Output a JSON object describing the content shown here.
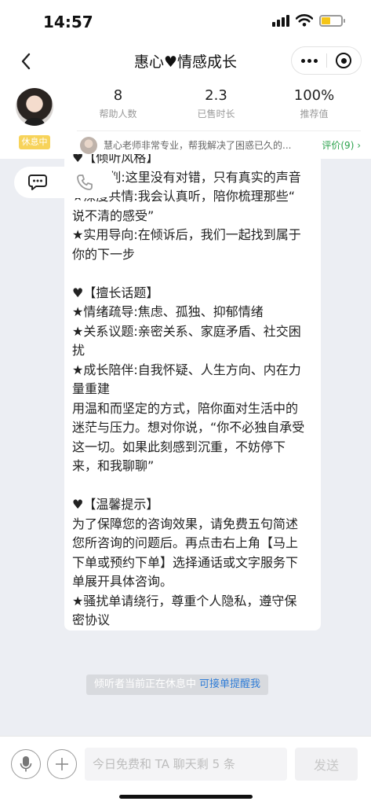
{
  "status_bar": {
    "time": "14:57"
  },
  "nav": {
    "title": "惠心♥情感成长"
  },
  "profile": {
    "status_badge": "休息中",
    "stats": [
      {
        "value": "8",
        "label": "帮助人数"
      },
      {
        "value": "2.3",
        "label": "已售时长"
      },
      {
        "value": "100%",
        "label": "推荐值"
      }
    ],
    "review_text": "慧心老师非常专业，帮我解决了困惑已久的...",
    "review_link": "评价(9) ›"
  },
  "message": {
    "lines": [
      "♥【倾听风格】",
      "★不评判:这里没有对错，只有真实的声音",
      "★深度共情:我会认真听，陪你梳理那些“",
      "说不清的感受”",
      "★实用导向:在倾诉后，我们一起找到属于",
      "你的下一步",
      "",
      "♥【擅长话题】",
      "★情绪疏导:焦虑、孤独、抑郁情绪",
      "★关系议题:亲密关系、家庭矛盾、社交困",
      "扰",
      "★成长陪伴:自我怀疑、人生方向、内在力",
      "量重建",
      "用温和而坚定的方式，陪你面对生活中的",
      "迷茫与压力。想对你说，“你不必独自承受",
      "这一切。如果此刻感到沉重，不妨停下",
      "来，和我聊聊”",
      "",
      "♥【温馨提示】",
      "为了保障您的咨询效果，请免费五句简述",
      "您所咨询的问题后。再点击右上角【马上",
      "下单或预约下单】选择通话或文字服务下",
      "单展开具体咨询。",
      "★骚扰单请绕行，尊重个人隐私，遵守保",
      "密协议"
    ]
  },
  "notice": {
    "text": "倾听者当前正在休息中",
    "link": "可接单提醒我"
  },
  "input_bar": {
    "placeholder": "今日免费和 TA 聊天剩 5 条",
    "send_label": "发送"
  }
}
